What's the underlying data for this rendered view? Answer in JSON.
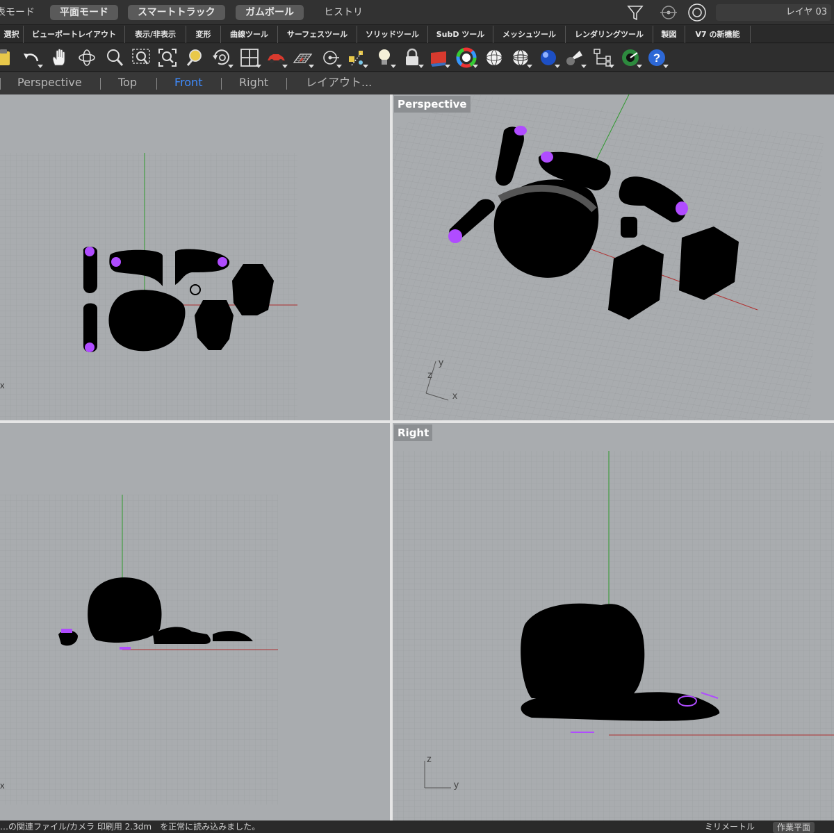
{
  "topbar": {
    "modes": [
      {
        "label": "表モード",
        "style": "plain"
      },
      {
        "label": "平面モード",
        "style": "btn"
      },
      {
        "label": "スマートトラック",
        "style": "btn"
      },
      {
        "label": "ガムボール",
        "style": "btn"
      },
      {
        "label": "ヒストリ",
        "style": "plain"
      }
    ],
    "layer": "レイヤ 03"
  },
  "tabs": [
    "選択",
    "ビューポートレイアウト",
    "表示/非表示",
    "変形",
    "曲線ツール",
    "サーフェスツール",
    "ソリッドツール",
    "SubD ツール",
    "メッシュツール",
    "レンダリングツール",
    "製図",
    "V7 の新機能"
  ],
  "toolbar": {
    "icons": [
      "clipboard-icon",
      "undo-icon",
      "pan-hand-icon",
      "rotate-view-icon",
      "zoom-icon",
      "zoom-window-icon",
      "zoom-extents-icon",
      "zoom-selected-icon",
      "rotate-camera-icon",
      "viewport-layout-icon",
      "car-icon",
      "grid-plane-icon",
      "point-snap-icon",
      "object-snap-icon",
      "light-bulb-icon",
      "lock-icon",
      "material-icon",
      "color-wheel-icon",
      "sphere-icon",
      "shaded-sphere-icon",
      "blue-sphere-icon",
      "light-cone-icon",
      "hierarchy-icon",
      "settings-icon",
      "help-icon"
    ]
  },
  "view_tabs": {
    "items": [
      "Perspective",
      "Top",
      "Front",
      "Right",
      "レイアウト..."
    ],
    "active": "Front"
  },
  "viewports": {
    "top_left": {
      "label": "",
      "axis_label": "x"
    },
    "perspective": {
      "label": "Perspective",
      "axis_x": "x",
      "axis_y": "y",
      "axis_z": "z"
    },
    "bottom_left": {
      "label": "",
      "axis_label": "x"
    },
    "right": {
      "label": "Right",
      "axis_y": "y",
      "axis_z": "z"
    }
  },
  "status": {
    "message": "…の関連ファイル/カメラ 印刷用 2.3dm　を正常に読み込みました。",
    "right1": "ミリメートル",
    "right2": "作業平面"
  },
  "colors": {
    "viewport_bg": "#a9acaf",
    "grid_line": "#9a9da0",
    "x_axis": "#b03030",
    "y_axis": "#2e9a2e",
    "highlight": "#b04cff",
    "active_tab": "#3f8cff"
  }
}
